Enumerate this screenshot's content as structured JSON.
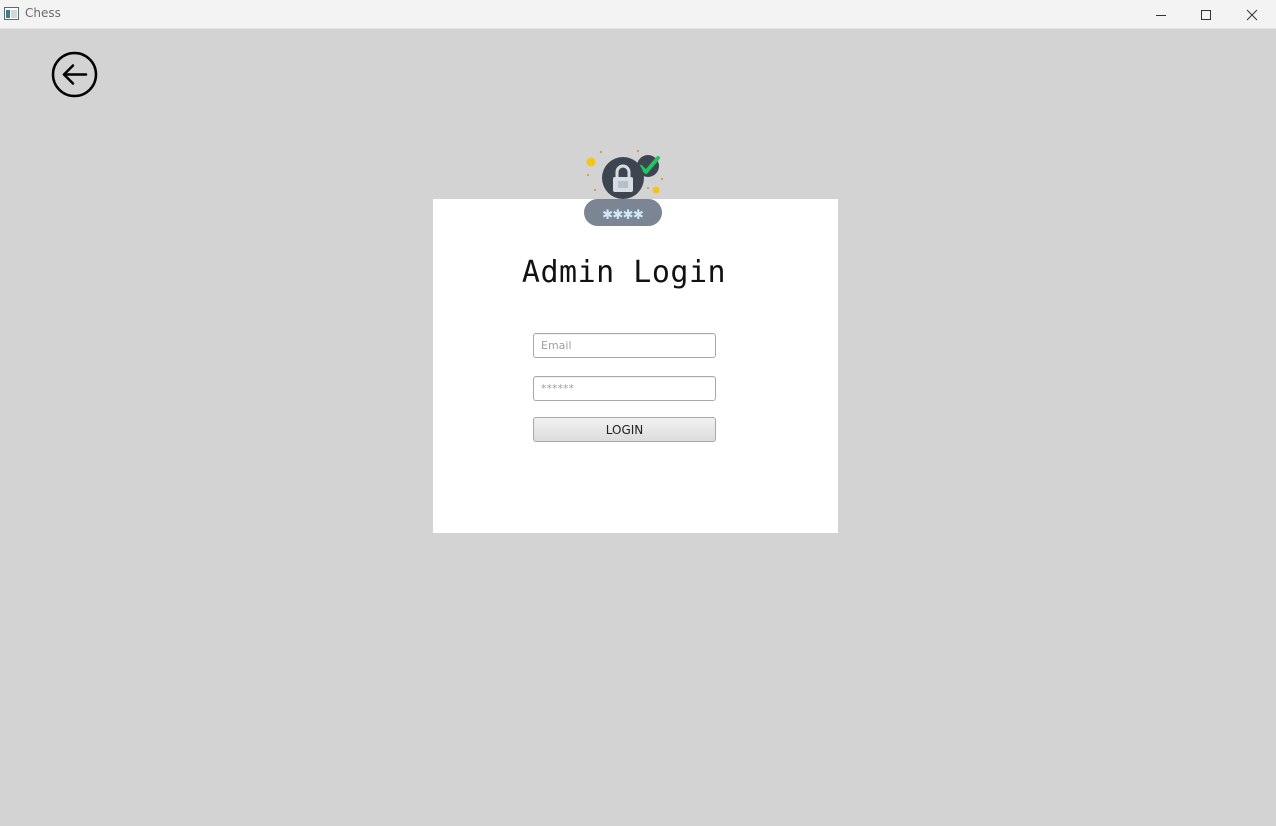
{
  "window": {
    "title": "Chess",
    "controls": {
      "minimize_icon": "minimize-icon",
      "maximize_icon": "maximize-icon",
      "close_icon": "close-icon"
    }
  },
  "nav": {
    "back_icon": "back-arrow-icon"
  },
  "login": {
    "title": "Admin Login",
    "email_placeholder": "Email",
    "password_placeholder": "******",
    "email_value": "",
    "password_value": "",
    "submit_label": "LOGIN",
    "illustration_icon": "padlock-password-icon"
  },
  "colors": {
    "background": "#d3d3d3",
    "card": "#ffffff",
    "lock_body": "#3d4550",
    "check": "#22c55e",
    "sparkle": "#f5c518"
  }
}
